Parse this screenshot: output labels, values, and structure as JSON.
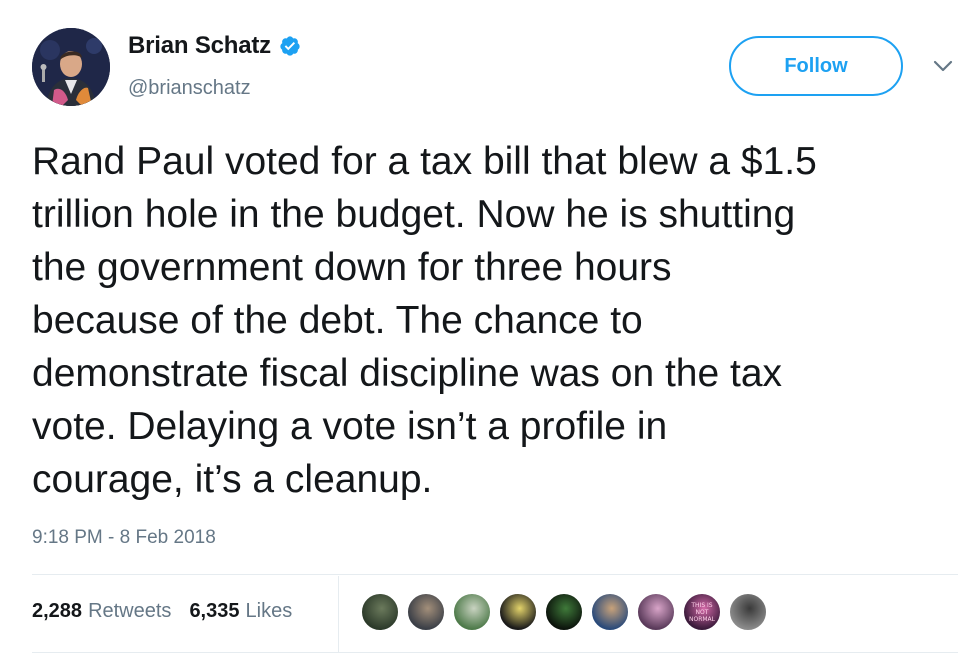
{
  "author": {
    "display_name": "Brian Schatz",
    "handle": "@brianschatz",
    "verified": true,
    "avatar_icon": "profile-photo"
  },
  "actions": {
    "follow_label": "Follow",
    "menu_icon": "chevron-down-icon"
  },
  "tweet": {
    "lines": [
      "Rand Paul voted for a tax bill that blew a $1.5",
      "trillion hole in the budget. Now he is shutting",
      "the government down for three hours",
      "because of the debt. The chance to",
      "demonstrate fiscal discipline was on the tax",
      "vote. Delaying a vote isn’t a profile in",
      "courage, it’s a cleanup."
    ],
    "timestamp": "9:18 PM - 8 Feb 2018"
  },
  "stats": {
    "retweets_count": "2,288",
    "retweets_label": "Retweets",
    "likes_count": "6,335",
    "likes_label": "Likes"
  },
  "likers": [
    {
      "colors": [
        "#2c3a2a",
        "#6b7a5c"
      ]
    },
    {
      "colors": [
        "#3b3f47",
        "#a38f7a"
      ]
    },
    {
      "colors": [
        "#4e7a4a",
        "#c9d3c1"
      ]
    },
    {
      "colors": [
        "#1a1a1a",
        "#e3d36a"
      ]
    },
    {
      "colors": [
        "#0c140c",
        "#3f7a3a"
      ]
    },
    {
      "colors": [
        "#2a4a7a",
        "#c8a27a"
      ]
    },
    {
      "colors": [
        "#5a3a5a",
        "#d8a4c8"
      ]
    },
    {
      "colors": [
        "#3a1a3a",
        "#d46aa8"
      ],
      "text": "THIS IS NOT NORMAL"
    },
    {
      "colors": [
        "#8a8a8a",
        "#3a3a3a"
      ]
    }
  ],
  "colors": {
    "accent": "#1da1f2",
    "text_primary": "#14171a",
    "text_secondary": "#657786",
    "divider": "#e6ecf0"
  }
}
